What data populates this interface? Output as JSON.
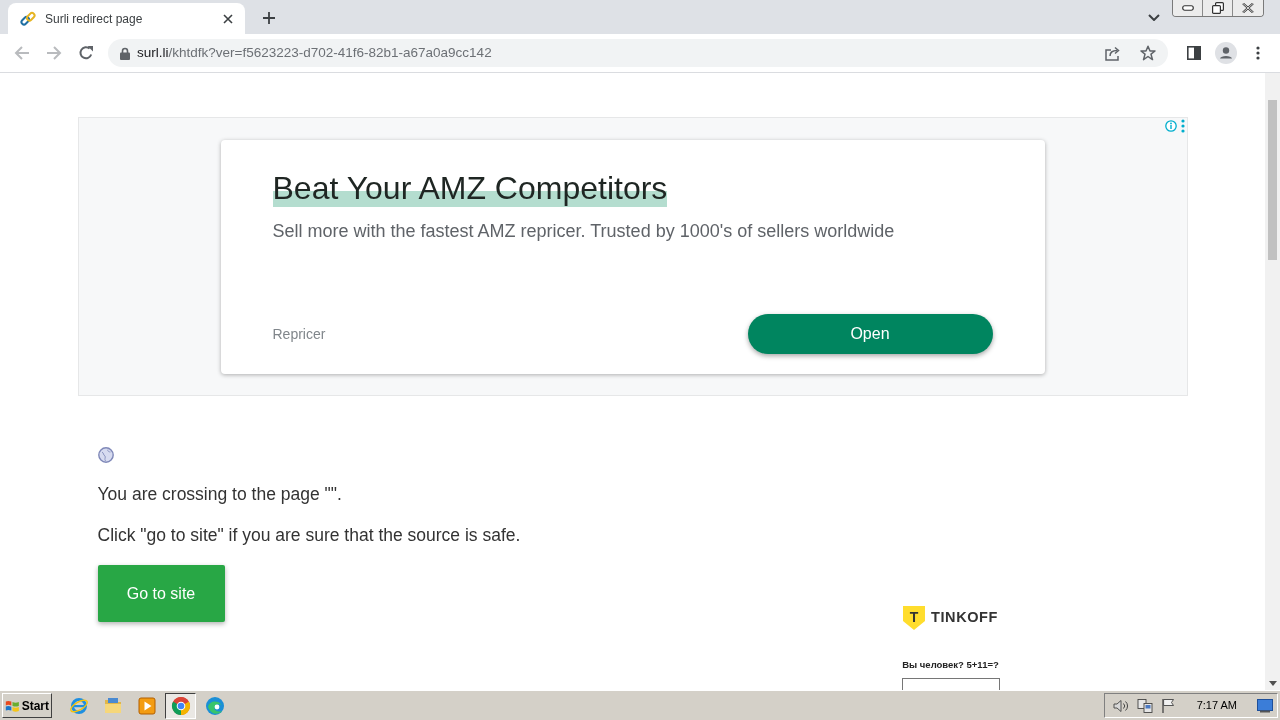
{
  "browser": {
    "tabs": [
      {
        "title": "Surli redirect page",
        "selected": true
      }
    ],
    "address": {
      "host": "surl.li",
      "path": "/khtdfk?ver=f5623223-d702-41f6-82b1-a67a0a9cc142"
    }
  },
  "ad": {
    "title": "Beat Your AMZ Competitors",
    "description": "Sell more with the fastest AMZ repricer. Trusted by 1000's of sellers worldwide",
    "advertiser": "Repricer",
    "button": "Open"
  },
  "notice": {
    "lines": [
      "You are crossing to the page \"\".",
      "Click \"go to site\" if you are sure that the source is safe."
    ],
    "button": "Go to site"
  },
  "captcha": {
    "logo_letter": "T",
    "brand": "TINKOFF",
    "question": "Вы человек? 5+11=?"
  },
  "taskbar": {
    "start": "Start",
    "apps": [
      {
        "kind": "ie",
        "selected": false
      },
      {
        "kind": "folder",
        "selected": false
      },
      {
        "kind": "media",
        "selected": false
      },
      {
        "kind": "chrome",
        "selected": true
      },
      {
        "kind": "edge",
        "selected": false
      }
    ],
    "clock": "7:17 AM"
  }
}
